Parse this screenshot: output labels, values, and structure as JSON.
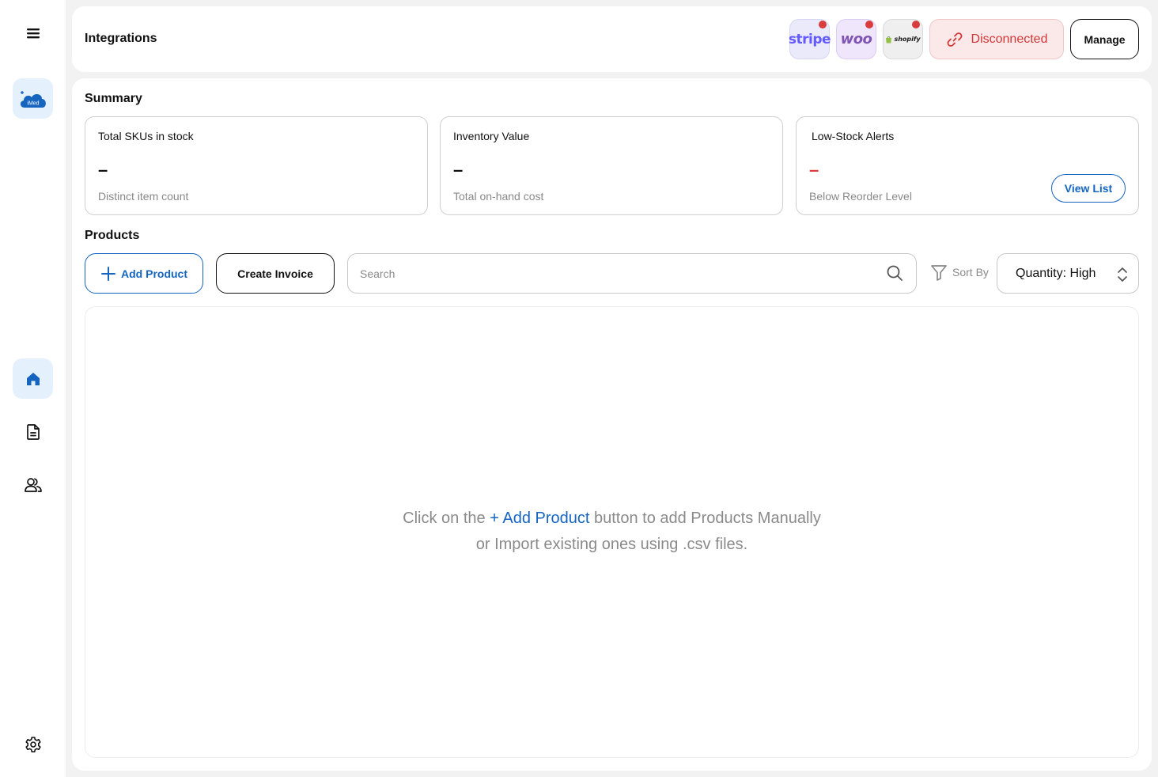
{
  "sidebar": {
    "menu_icon": "hamburger-menu-icon",
    "logo_text": "iMed",
    "nav": [
      {
        "name": "home",
        "icon": "home-icon",
        "active": true
      },
      {
        "name": "documents",
        "icon": "document-icon",
        "active": false
      },
      {
        "name": "users",
        "icon": "users-icon",
        "active": false
      }
    ],
    "settings_icon": "gear-icon"
  },
  "header": {
    "title": "Integrations",
    "integrations": [
      {
        "name": "stripe",
        "label": "stripe",
        "status_dot": true
      },
      {
        "name": "woo",
        "label": "woo",
        "status_dot": true
      },
      {
        "name": "shopify",
        "label": "shopify",
        "status_dot": true
      }
    ],
    "status_label": "Disconnected",
    "manage_label": "Manage"
  },
  "summary": {
    "title": "Summary",
    "cards": [
      {
        "label": "Total SKUs in stock",
        "value": "–",
        "sub": "Distinct item count"
      },
      {
        "label": "Inventory Value",
        "value": "–",
        "sub": "Total on-hand cost"
      },
      {
        "label": "Low-Stock Alerts",
        "value": "–",
        "sub": "Below Reorder Level",
        "action": "View List"
      }
    ]
  },
  "products": {
    "title": "Products",
    "add_label": "Add Product",
    "invoice_label": "Create Invoice",
    "search_placeholder": "Search",
    "sort_label": "Sort By",
    "sort_value": "Quantity: High",
    "empty_prefix": "Click on the ",
    "empty_link": "+ Add Product",
    "empty_suffix": " button to add Products Manually",
    "empty_line2": "or Import existing ones using .csv files."
  },
  "colors": {
    "accent": "#1565c0",
    "danger": "#d23737",
    "active_bg": "#e4f1fc"
  }
}
